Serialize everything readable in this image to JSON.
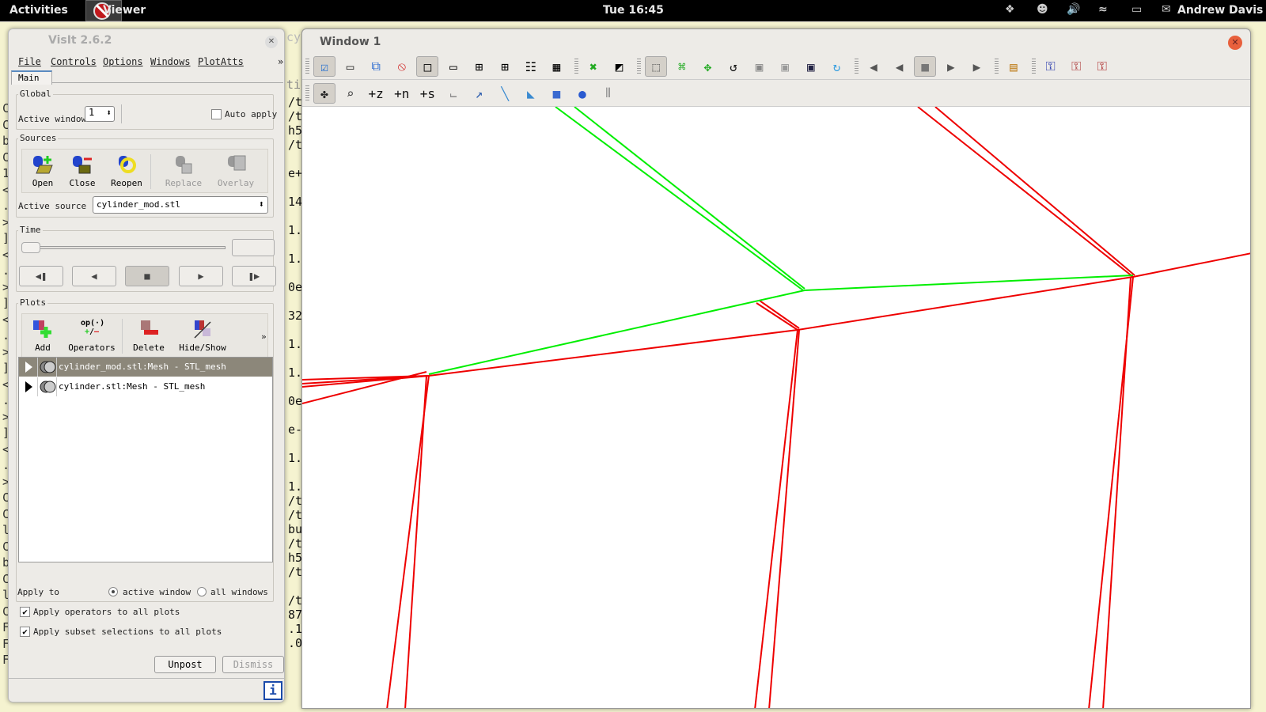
{
  "topbar": {
    "activities": "Activities",
    "app_name": "Viewer",
    "clock": "Tue 16:45",
    "user": "Andrew Davis",
    "tray_icons": [
      "dropbox-icon",
      "accessibility-icon",
      "volume-icon",
      "wifi-icon",
      "battery-icon",
      "chat-icon"
    ]
  },
  "terminal": {
    "right_column": [
      "/t",
      "/t",
      "h5",
      "/t",
      "",
      "e+",
      "",
      "14",
      "",
      "1.",
      "",
      "1.",
      "",
      "0e",
      "",
      "32",
      "",
      "1.",
      "",
      "1.",
      "",
      "0e",
      "",
      "e-",
      "",
      "1.",
      "",
      "1.",
      "/t",
      "/t",
      "bu",
      "/t",
      "h5",
      "/t",
      "",
      "/t",
      "87",
      ".1",
      ".0"
    ],
    "left_column": [
      "C",
      "C",
      "b",
      "C",
      "1",
      "<",
      ".",
      ">",
      "]",
      "<",
      ".",
      ">",
      "]",
      "<",
      ".",
      ">",
      "]",
      "<",
      ".",
      ">",
      "]",
      "<",
      ".",
      ">",
      "C",
      "C",
      "l",
      "C",
      "b",
      "C",
      "l",
      "C",
      "F",
      "F",
      "F"
    ],
    "tab_fragment_1": "cyl",
    "tab_fragment_2": "tig"
  },
  "visit": {
    "title": "VisIt 2.6.2",
    "menu": [
      "File",
      "Controls",
      "Options",
      "Windows",
      "PlotAtts"
    ],
    "menu_more": "»",
    "tab": "Main",
    "global": {
      "label": "Global",
      "active_window_label": "Active window",
      "active_window_value": "1",
      "auto_apply_label": "Auto apply",
      "auto_apply_checked": false
    },
    "sources": {
      "label": "Sources",
      "buttons": [
        {
          "label": "Open",
          "icon": "open-database-icon",
          "enabled": true
        },
        {
          "label": "Close",
          "icon": "close-database-icon",
          "enabled": true
        },
        {
          "label": "Reopen",
          "icon": "reopen-database-icon",
          "enabled": true
        },
        {
          "label": "Replace",
          "icon": "replace-database-icon",
          "enabled": false
        },
        {
          "label": "Overlay",
          "icon": "overlay-database-icon",
          "enabled": false
        }
      ],
      "active_source_label": "Active source",
      "active_source_value": "cylinder_mod.stl"
    },
    "time": {
      "label": "Time",
      "slider_value": 0,
      "value": "",
      "buttons": [
        "prev-frame",
        "reverse-play",
        "stop",
        "play",
        "next-frame"
      ]
    },
    "plots": {
      "label": "Plots",
      "buttons": [
        {
          "label": "Add",
          "icon": "add-plot-icon"
        },
        {
          "label": "Operators",
          "icon": "operators-icon",
          "icon_text": "op(·)"
        },
        {
          "label": "Delete",
          "icon": "delete-plot-icon"
        },
        {
          "label": "Hide/Show",
          "icon": "hide-show-icon"
        }
      ],
      "more": "»",
      "list": [
        {
          "label": "cylinder_mod.stl:Mesh - STL_mesh",
          "selected": true
        },
        {
          "label": "cylinder.stl:Mesh - STL_mesh",
          "selected": false
        }
      ]
    },
    "apply_to": {
      "label": "Apply to",
      "options": [
        "active window",
        "all windows"
      ],
      "selected": "active window"
    },
    "apply_operators": {
      "label": "Apply operators to all plots",
      "checked": true
    },
    "apply_subsets": {
      "label": "Apply subset selections to all plots",
      "checked": true
    },
    "unpost": "Unpost",
    "dismiss": "Dismiss"
  },
  "viewer": {
    "title": "Window 1",
    "toolbar1": [
      "active-window-icon",
      "new-window-icon",
      "clone-window-icon",
      "delete-window-icon",
      "layout-1x1-icon",
      "layout-1x2-icon",
      "layout-2x2-icon",
      "layout-2x3-icon",
      "layout-2x4-icon",
      "layout-3x3-icon",
      "clear-plots-icon",
      "invert-background-icon",
      "perspective-icon",
      "recenter-view-icon",
      "undo-view-icon",
      "reset-view-icon",
      "save-view-icon",
      "choose-view-icon",
      "save-image-icon",
      "spin-icon",
      "prev-frame-icon",
      "reverse-play-icon",
      "stop-icon",
      "play-icon",
      "next-frame-icon",
      "color-table-icon",
      "lock-view-icon",
      "lock-time-icon",
      "lock-tools-icon"
    ],
    "toolbar2": [
      "navigate-icon",
      "zoom-icon",
      "zone-pick-icon",
      "node-pick-icon",
      "spreadsheet-pick-icon",
      "curve-pick-icon",
      "lineout-icon",
      "line-tool-icon",
      "plane-tool-icon",
      "box-tool-icon",
      "sphere-tool-icon",
      "axis-restriction-icon"
    ],
    "plot_colors": {
      "mod_mesh": "#00ee00",
      "orig_mesh": "#ee0000"
    }
  }
}
